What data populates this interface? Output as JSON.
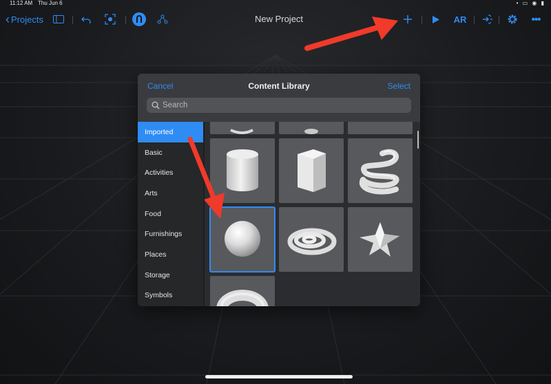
{
  "status_bar": {
    "time": "11:12 AM",
    "date": "Thu Jun 6",
    "indicators": "• ▭ ◉ ▮"
  },
  "toolbar": {
    "back_label": "Projects",
    "title": "New Project",
    "ar_label": "AR",
    "accent": "#2f8cf3",
    "icons": [
      "sidebar-toggle-icon",
      "undo-icon",
      "anchor-icon",
      "gesture-icon",
      "hierarchy-icon",
      "add-icon",
      "play-icon",
      "ar-icon",
      "behaviors-icon",
      "settings-icon",
      "more-icon"
    ]
  },
  "library": {
    "cancel_label": "Cancel",
    "title": "Content Library",
    "select_label": "Select",
    "search_placeholder": "Search",
    "categories": [
      "Imported",
      "Basic",
      "Activities",
      "Arts",
      "Food",
      "Furnishings",
      "Places",
      "Storage",
      "Symbols"
    ],
    "active_category": "Imported",
    "items": [
      "cylinder",
      "hexagonal-prism",
      "helix",
      "sphere",
      "spiral",
      "star",
      "torus"
    ],
    "selected_item": "sphere"
  },
  "annotation_color": "#f03a2a"
}
